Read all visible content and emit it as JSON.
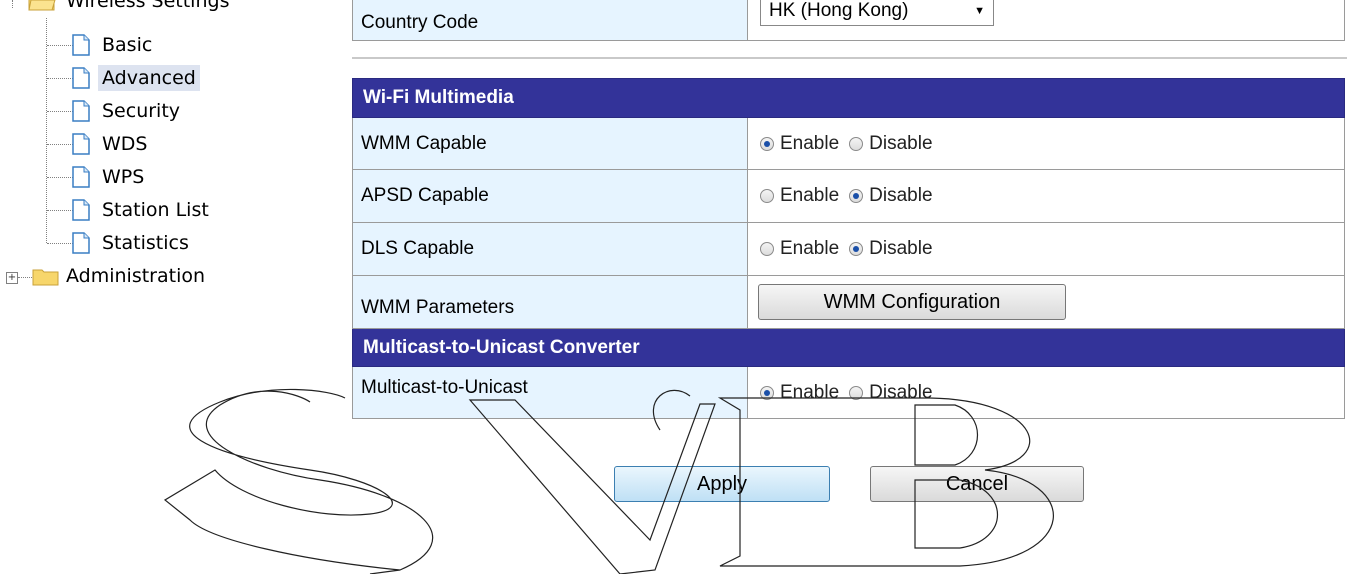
{
  "tree": {
    "parent_label": "Wireless Settings",
    "children": [
      "Basic",
      "Advanced",
      "Security",
      "WDS",
      "WPS",
      "Station List",
      "Statistics"
    ],
    "selected": "Advanced",
    "sibling_label": "Administration"
  },
  "country": {
    "label": "Country Code",
    "value": "HK (Hong Kong)"
  },
  "wmm_section": {
    "header": "Wi-Fi Multimedia",
    "rows": [
      {
        "label": "WMM Capable",
        "enable": "Enable",
        "disable": "Disable",
        "selected": "enable"
      },
      {
        "label": "APSD Capable",
        "enable": "Enable",
        "disable": "Disable",
        "selected": "disable"
      },
      {
        "label": "DLS Capable",
        "enable": "Enable",
        "disable": "Disable",
        "selected": "disable"
      }
    ],
    "params_label": "WMM Parameters",
    "params_button": "WMM Configuration"
  },
  "mcast_section": {
    "header": "Multicast-to-Unicast Converter",
    "label": "Multicast-to-Unicast",
    "enable": "Enable",
    "disable": "Disable",
    "selected": "enable"
  },
  "actions": {
    "apply": "Apply",
    "cancel": "Cancel"
  },
  "watermark": "SVB"
}
